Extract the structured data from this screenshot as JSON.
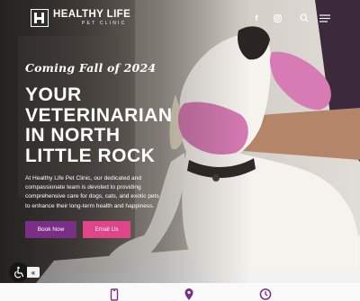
{
  "brand": {
    "name": "HEALTHY LIFE",
    "sub": "PET CLINIC"
  },
  "nav": {
    "facebook_icon": "facebook-icon",
    "instagram_icon": "instagram-icon",
    "search_icon": "search-icon",
    "menu_icon": "hamburger-menu-icon"
  },
  "hero": {
    "tagline": "Coming Fall of 2024",
    "headline": [
      "YOUR",
      "VETERINARIAN",
      "IN NORTH",
      "LITTLE ROCK"
    ],
    "blurb": "At Healthy Life Pet Clinic, our dedicated and compassionate team is devoted to providing comprehensive care for dogs, cats, and exotic pets to enhance their long-term health and happiness."
  },
  "cta": {
    "book_label": "Book Now",
    "email_label": "Email Us"
  },
  "accessibility": {
    "toggle_label": "«"
  },
  "colors": {
    "purple": "#7a2f86",
    "pink": "#e0458a",
    "glove": "#d77bb4",
    "white": "#ffffff"
  }
}
